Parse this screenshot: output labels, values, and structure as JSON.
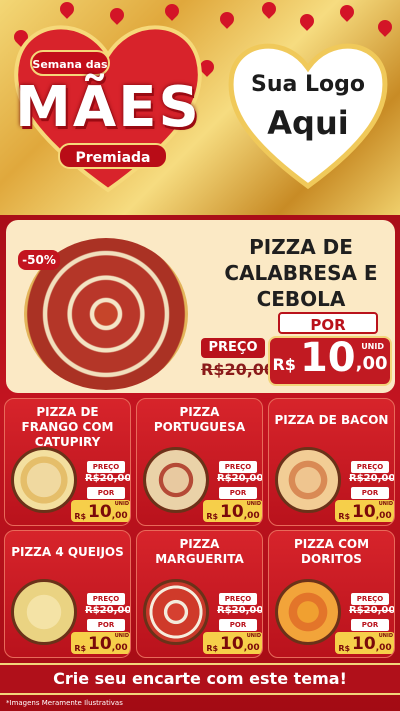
{
  "header": {
    "badge_top": "Semana das",
    "title": "MÃES",
    "subtitle": "Premiada",
    "logo_line1": "Sua Logo",
    "logo_line2": "Aqui"
  },
  "featured": {
    "discount": "-50%",
    "name": "PIZZA DE CALABRESA E CEBOLA",
    "preco_label": "PREÇO",
    "old_price": "R$20,00",
    "por_label": "POR",
    "currency": "R$",
    "price_int": "10",
    "price_cents": ",00",
    "unit": "UNID"
  },
  "cards": [
    {
      "name": "PIZZA DE FRANGO COM CATUPIRY",
      "preco_label": "PREÇO",
      "old_price": "R$20,00",
      "por_label": "POR",
      "currency": "R$",
      "price_int": "10",
      "price_cents": ",00",
      "unit": "UNID"
    },
    {
      "name": "PIZZA PORTUGUESA",
      "preco_label": "PREÇO",
      "old_price": "R$20,00",
      "por_label": "POR",
      "currency": "R$",
      "price_int": "10",
      "price_cents": ",00",
      "unit": "UNID"
    },
    {
      "name": "PIZZA DE BACON",
      "preco_label": "PREÇO",
      "old_price": "R$20,00",
      "por_label": "POR",
      "currency": "R$",
      "price_int": "10",
      "price_cents": ",00",
      "unit": "UNID"
    },
    {
      "name": "PIZZA 4 QUEIJOS",
      "preco_label": "PREÇO",
      "old_price": "R$20,00",
      "por_label": "POR",
      "currency": "R$",
      "price_int": "10",
      "price_cents": ",00",
      "unit": "UNID"
    },
    {
      "name": "PIZZA MARGUERITA",
      "preco_label": "PREÇO",
      "old_price": "R$20,00",
      "por_label": "POR",
      "currency": "R$",
      "price_int": "10",
      "price_cents": ",00",
      "unit": "UNID"
    },
    {
      "name": "PIZZA COM DORITOS",
      "preco_label": "PREÇO",
      "old_price": "R$20,00",
      "por_label": "POR",
      "currency": "R$",
      "price_int": "10",
      "price_cents": ",00",
      "unit": "UNID"
    }
  ],
  "banner": "Crie seu encarte com este tema!",
  "footnote": "*Imagens Meramente Ilustrativas",
  "colors": {
    "brand_red": "#c11a22",
    "gold": "#f3d57a",
    "cream": "#fbe9c5"
  }
}
